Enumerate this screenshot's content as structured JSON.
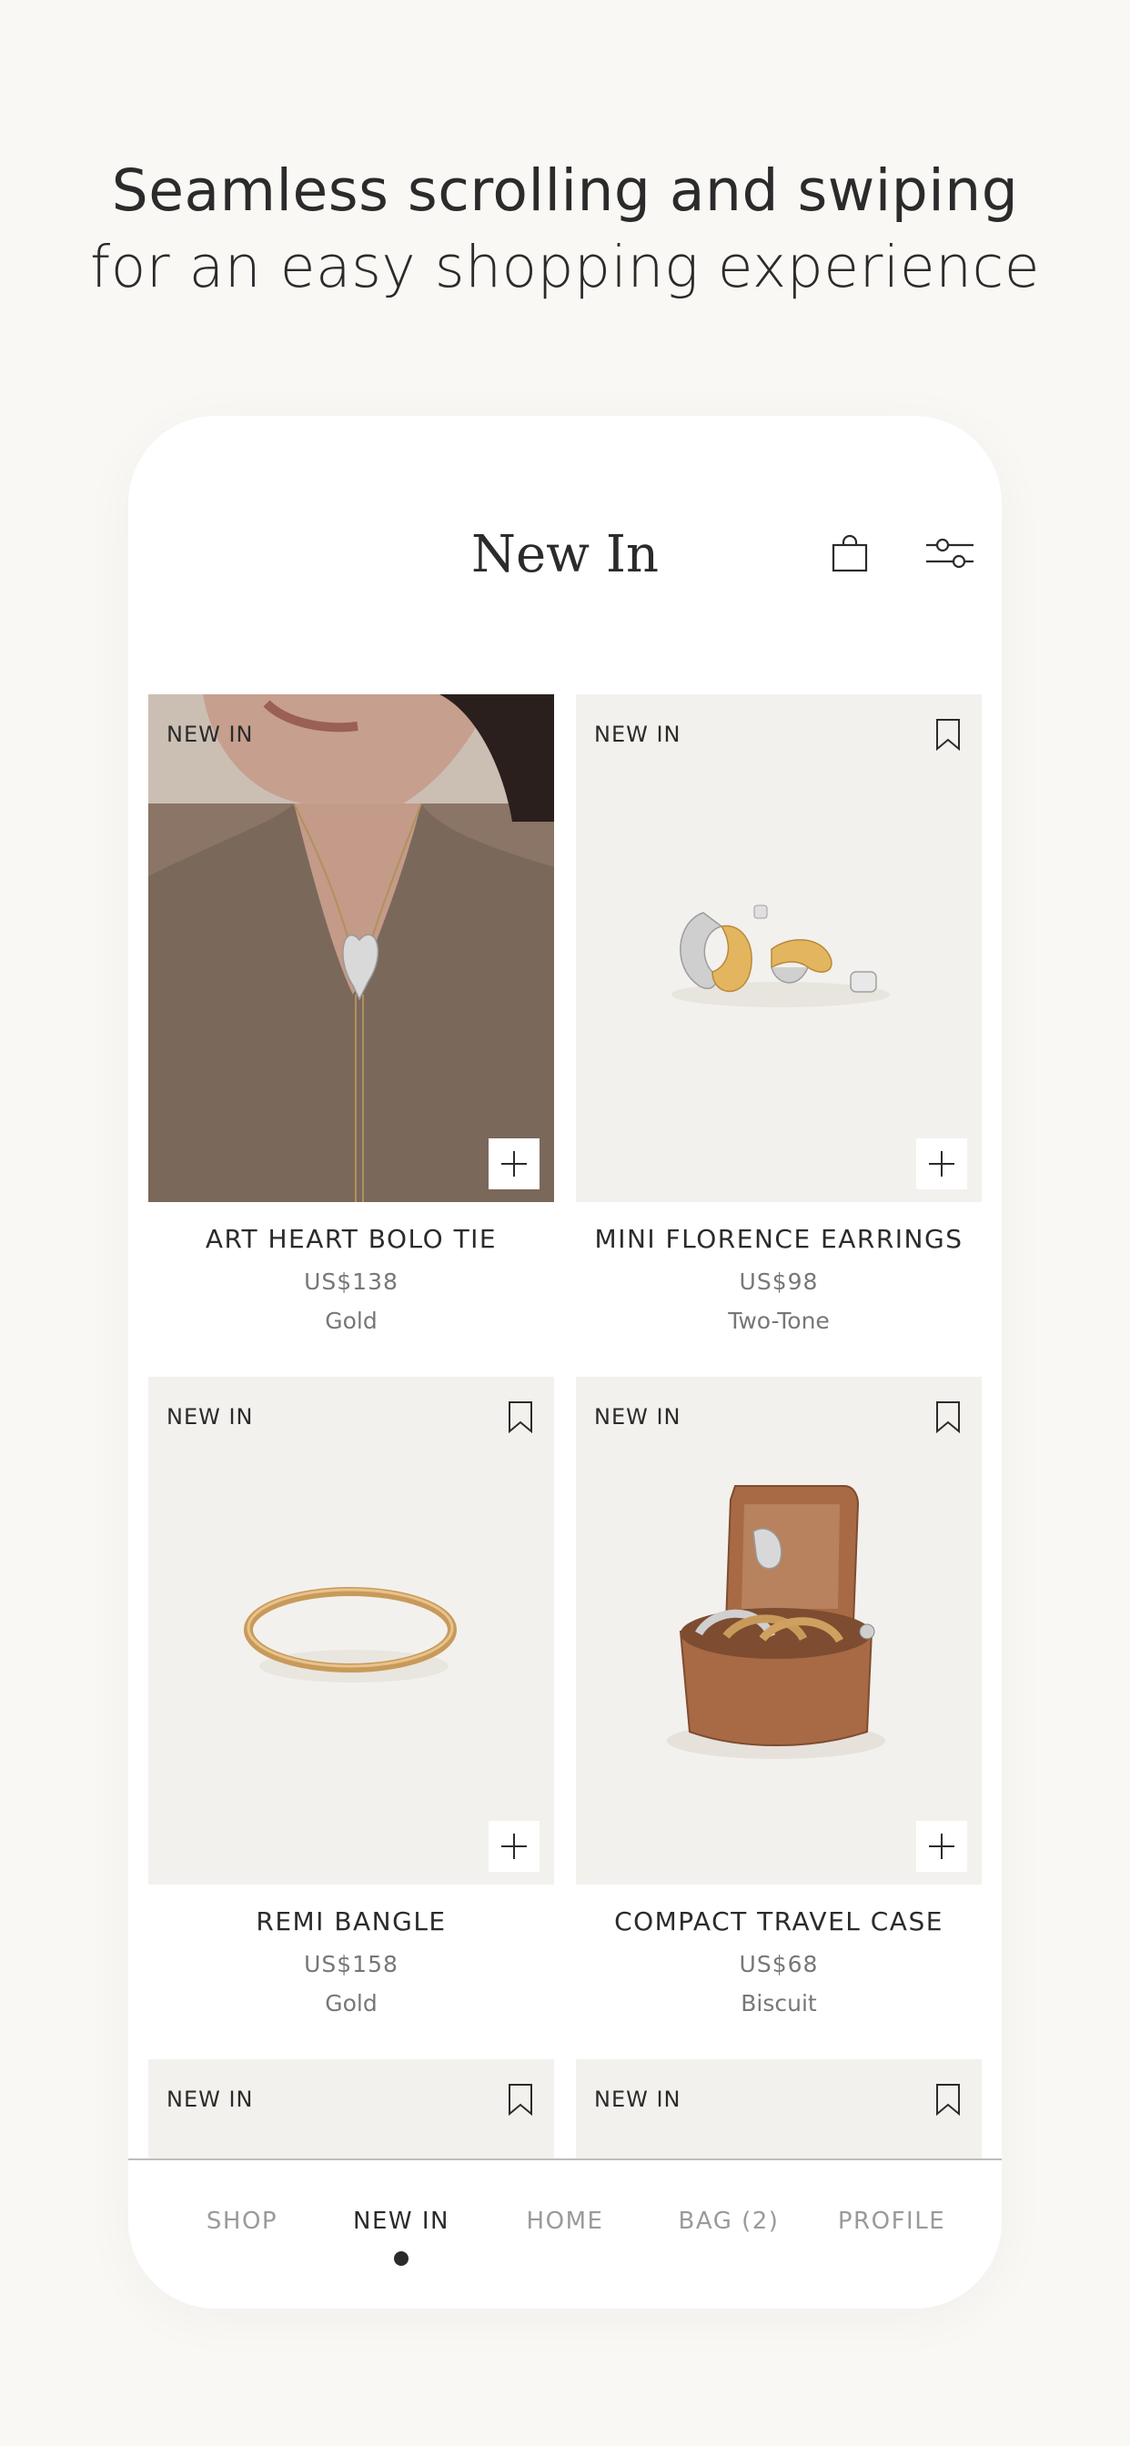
{
  "headline": {
    "line1": "Seamless scrolling and swiping",
    "line2": "for an easy shopping experience"
  },
  "header": {
    "title": "New In",
    "bag_icon": "shopping-bag-icon",
    "filter_icon": "filter-sliders-icon"
  },
  "products": [
    {
      "badge": "NEW IN",
      "name": "ART HEART BOLO TIE",
      "price": "US$138",
      "variant": "Gold",
      "image": "necklace-photo"
    },
    {
      "badge": "NEW IN",
      "name": "MINI FLORENCE EARRINGS",
      "price": "US$98",
      "variant": "Two-Tone",
      "image": "earrings-photo"
    },
    {
      "badge": "NEW IN",
      "name": "REMI BANGLE",
      "price": "US$158",
      "variant": "Gold",
      "image": "bangle-photo"
    },
    {
      "badge": "NEW IN",
      "name": "COMPACT TRAVEL CASE",
      "price": "US$68",
      "variant": "Biscuit",
      "image": "travel-case-photo"
    },
    {
      "badge": "NEW IN"
    },
    {
      "badge": "NEW IN"
    }
  ],
  "tabs": [
    {
      "label": "SHOP",
      "active": false
    },
    {
      "label": "NEW IN",
      "active": true
    },
    {
      "label": "HOME",
      "active": false
    },
    {
      "label": "BAG (2)",
      "active": false
    },
    {
      "label": "PROFILE",
      "active": false
    }
  ],
  "colors": {
    "background": "#f9f8f5",
    "card_bg": "#f3f1ed",
    "text": "#2b2b2b",
    "muted": "#777777",
    "gold": "#c89a5a",
    "leather": "#a86a45"
  }
}
